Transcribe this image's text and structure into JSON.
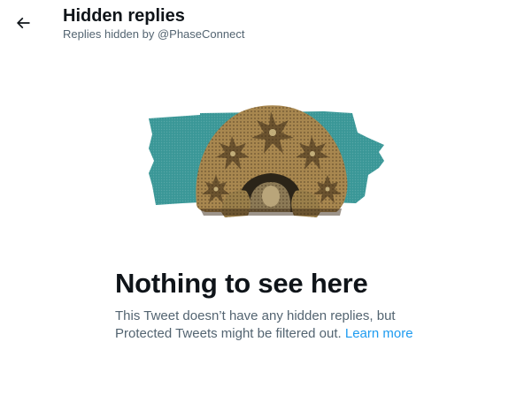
{
  "header": {
    "back_icon": "arrow-left-icon",
    "title": "Hidden replies",
    "subtitle": "Replies hidden by @PhaseConnect"
  },
  "illustration": {
    "subject": "tortoise-illustration",
    "background_color": "#3a9797"
  },
  "empty_state": {
    "title": "Nothing to see here",
    "body": "This Tweet doesn’t have any hidden replies, but Protected Tweets might be filtered out.",
    "link_label": "Learn more",
    "link_color": "#1d9bf0"
  },
  "colors": {
    "text_primary": "#0f1419",
    "text_secondary": "#536471",
    "accent": "#1d9bf0"
  }
}
